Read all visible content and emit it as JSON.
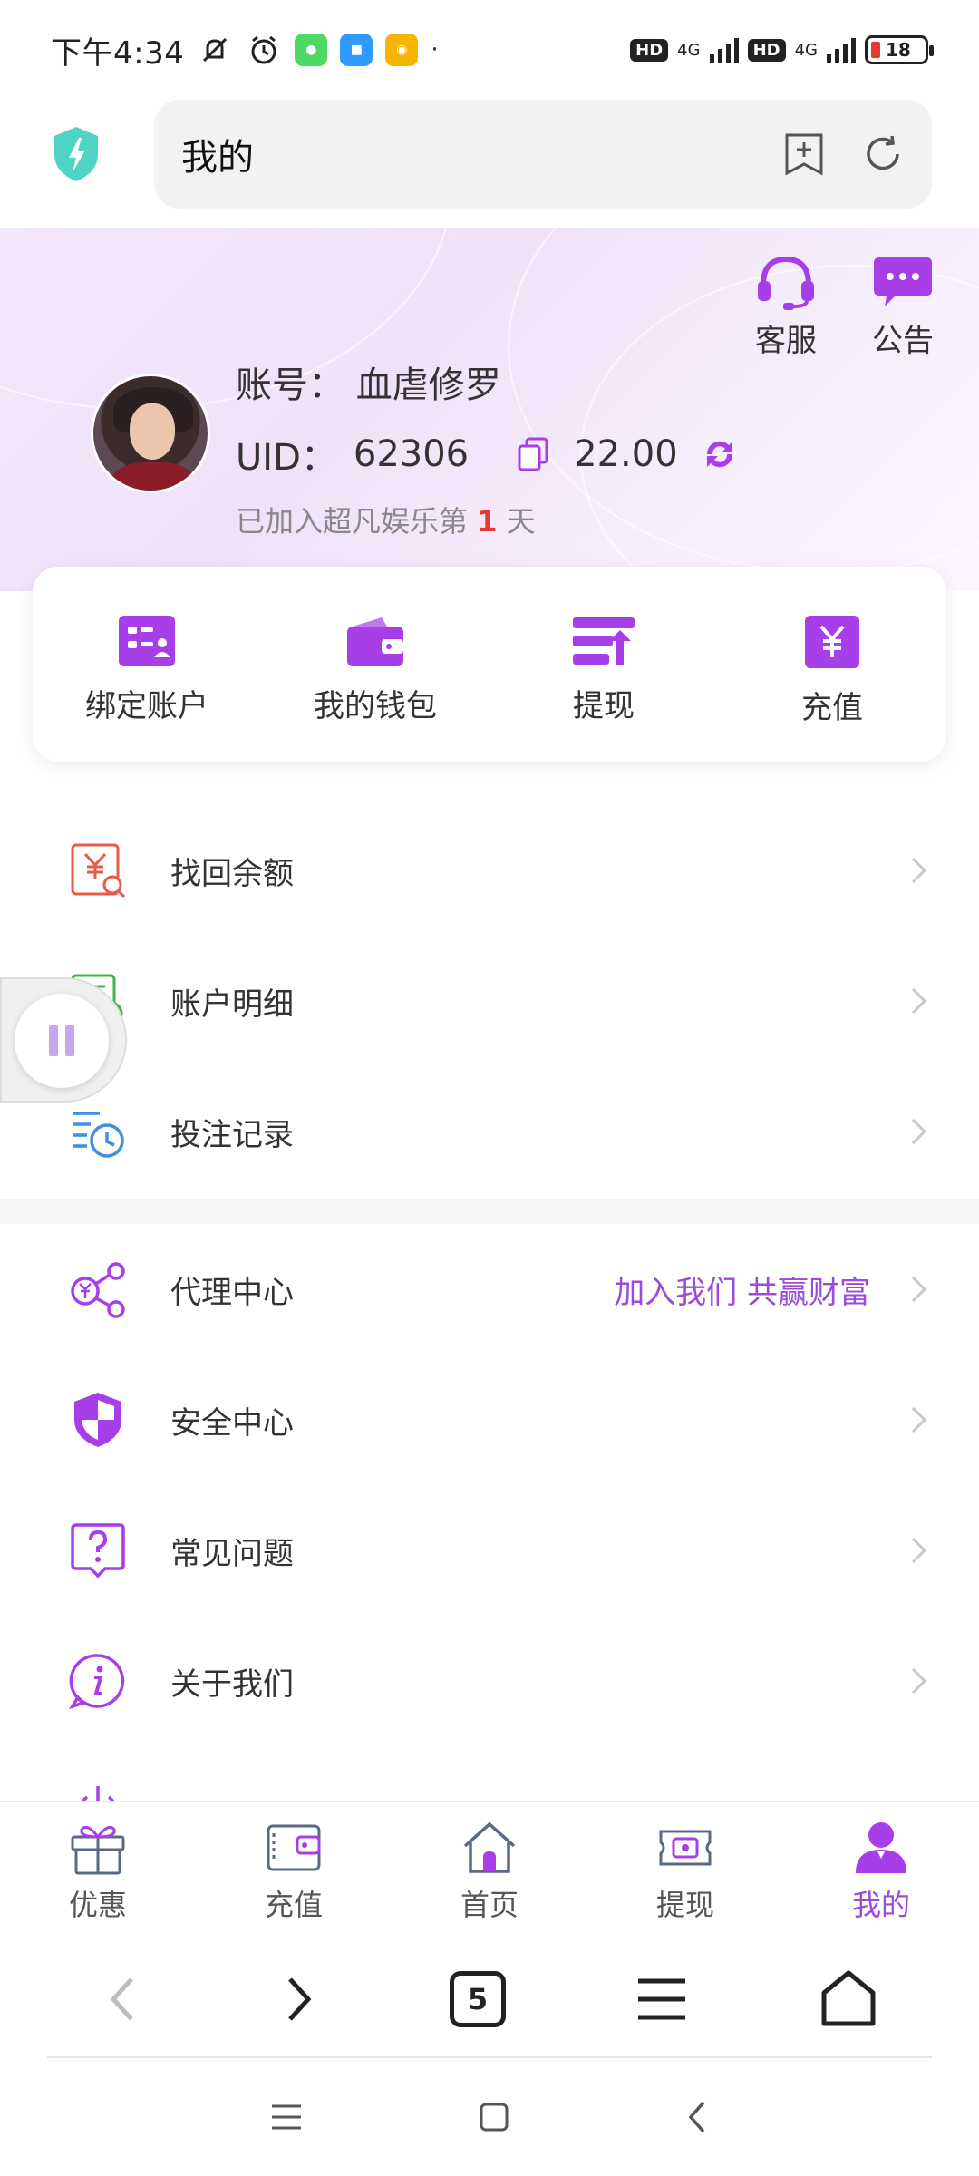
{
  "status_bar": {
    "time": "下午4:34",
    "network1": "4G",
    "network2": "4G",
    "hd1": "HD",
    "hd2": "HD",
    "battery": "18"
  },
  "address_bar": {
    "title": "我的"
  },
  "profile": {
    "account_label": "账号：",
    "account_value": "血虐修罗",
    "uid_label": "UID：",
    "uid_value": "62306",
    "balance": "22.00",
    "joined_prefix": "已加入超凡娱乐第",
    "joined_days": "1",
    "joined_suffix": "天",
    "support_label": "客服",
    "notice_label": "公告"
  },
  "quick_actions": [
    {
      "label": "绑定账户"
    },
    {
      "label": "我的钱包"
    },
    {
      "label": "提现"
    },
    {
      "label": "充值"
    }
  ],
  "menu_top": [
    {
      "label": "找回余额"
    },
    {
      "label": "账户明细"
    },
    {
      "label": "投注记录"
    }
  ],
  "menu_bottom": [
    {
      "label": "代理中心",
      "extra": "加入我们 共赢财富"
    },
    {
      "label": "安全中心"
    },
    {
      "label": "常见问题"
    },
    {
      "label": "关于我们"
    }
  ],
  "tabs": [
    {
      "label": "优惠"
    },
    {
      "label": "充值"
    },
    {
      "label": "首页"
    },
    {
      "label": "提现"
    },
    {
      "label": "我的"
    }
  ],
  "browser_nav": {
    "tab_count": "5"
  },
  "colors": {
    "accent": "#9a4bd9",
    "highlight": "#e53935"
  }
}
